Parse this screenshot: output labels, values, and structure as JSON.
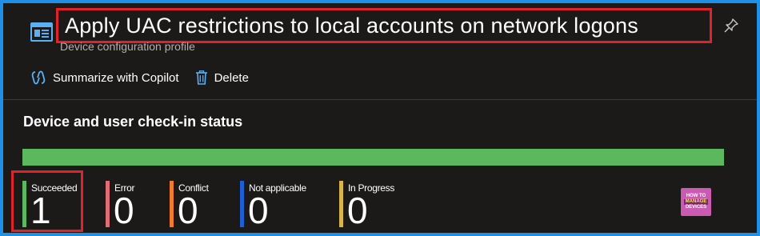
{
  "header": {
    "title": "Apply UAC restrictions to local accounts on network logons",
    "subtitle": "Device configuration profile"
  },
  "toolbar": {
    "copilot_label": "Summarize with Copilot",
    "delete_label": "Delete"
  },
  "section": {
    "title": "Device and user check-in status"
  },
  "progress": {
    "succeeded_fraction": 1.0
  },
  "stats": [
    {
      "label": "Succeeded",
      "value": "1",
      "color": "#5cb85c"
    },
    {
      "label": "Error",
      "value": "0",
      "color": "#e06c75"
    },
    {
      "label": "Conflict",
      "value": "0",
      "color": "#f07b2d"
    },
    {
      "label": "Not applicable",
      "value": "0",
      "color": "#1f5fd6"
    },
    {
      "label": "In Progress",
      "value": "0",
      "color": "#d8b54a"
    }
  ],
  "logo": {
    "line1": "HOW TO",
    "line2": "MANAGE",
    "line3": "DEVICES"
  },
  "colors": {
    "page_border": "#1e90e6",
    "background": "#1b1a19",
    "highlight": "#e0232a"
  }
}
